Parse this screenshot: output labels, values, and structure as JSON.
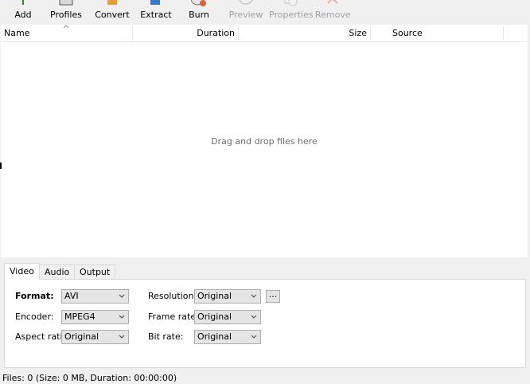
{
  "toolbar": {
    "add": "Add",
    "profiles": "Profiles",
    "convert": "Convert",
    "extract": "Extract",
    "burn": "Burn",
    "preview": "Preview",
    "properties": "Properties",
    "remove": "Remove"
  },
  "file_list": {
    "columns": {
      "name": "Name",
      "duration": "Duration",
      "size": "Size",
      "source": "Source"
    },
    "empty_hint": "Drag and drop files here"
  },
  "tabs": [
    "Video",
    "Audio",
    "Output"
  ],
  "video": {
    "format_label": "Format:",
    "format_value": "AVI",
    "encoder_label": "Encoder:",
    "encoder_value": "MPEG4",
    "aspect_label": "Aspect ratio:",
    "aspect_value": "Original",
    "resolution_label": "Resolution:",
    "resolution_value": "Original",
    "resolution_more": "...",
    "framerate_label": "Frame rate:",
    "framerate_value": "Original",
    "bitrate_label": "Bit rate:",
    "bitrate_value": "Original"
  },
  "status": "Files: 0 (Size: 0 MB, Duration: 00:00:00)",
  "colors": {
    "window_bg": "#f0f0f0",
    "list_bg": "#ffffff",
    "disabled_text": "#a0a0a0",
    "convert_icon": "#e0a030",
    "extract_icon": "#3c78c8",
    "remove_icon": "#e06060"
  }
}
